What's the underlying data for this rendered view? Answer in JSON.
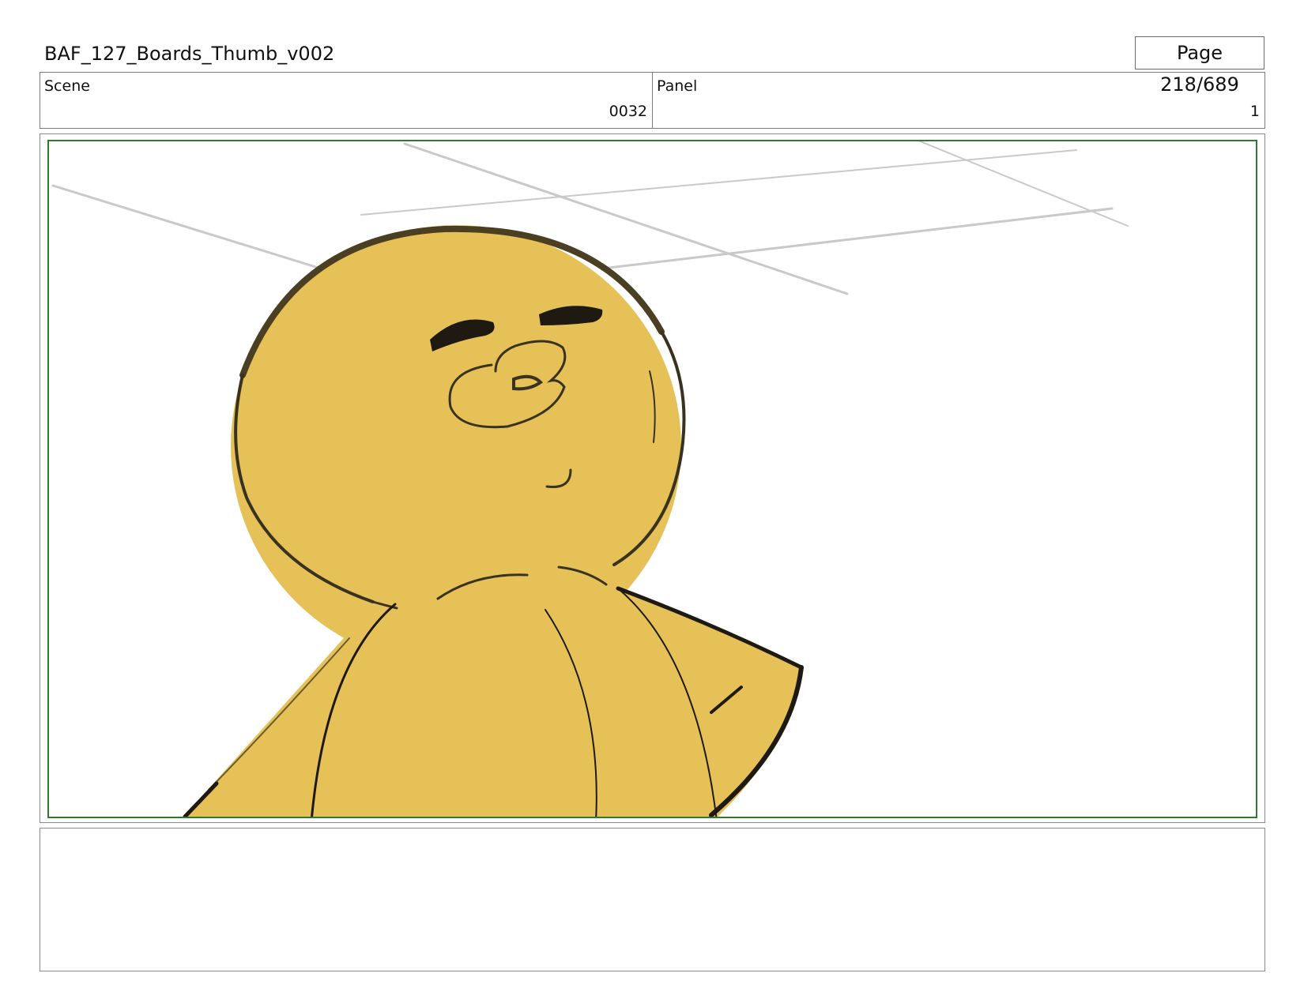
{
  "header": {
    "title": "BAF_127_Boards_Thumb_v002",
    "page_indicator": "Page 218/689"
  },
  "info": {
    "scene_label": "Scene",
    "scene_value": "0032",
    "panel_label": "Panel",
    "panel_value": "1"
  },
  "notes": {
    "text": ""
  },
  "colors": {
    "character_fill": "#e5c158",
    "frame_border": "#2f7a2f",
    "sketch_lines": "#c8c8c8"
  }
}
